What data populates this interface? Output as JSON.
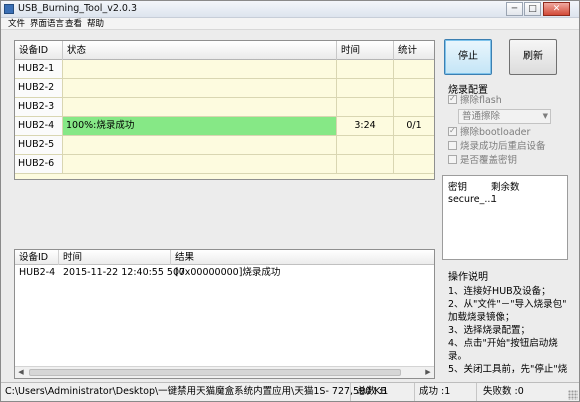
{
  "window": {
    "title": "USB_Burning_Tool_v2.0.3"
  },
  "titlebar": {
    "minimize": "─",
    "maximize": "□",
    "close": "✕"
  },
  "menu": [
    "文件",
    "界面语言",
    "查看",
    "帮助"
  ],
  "device_table": {
    "headers": [
      "设备ID",
      "状态",
      "时间",
      "统计"
    ],
    "rows": [
      {
        "id": "HUB2-1",
        "status": "",
        "time": "",
        "stat": ""
      },
      {
        "id": "HUB2-2",
        "status": "",
        "time": "",
        "stat": ""
      },
      {
        "id": "HUB2-3",
        "status": "",
        "time": "",
        "stat": ""
      },
      {
        "id": "HUB2-4",
        "status": "100%:烧录成功",
        "time": "3:24",
        "stat": "0/1"
      },
      {
        "id": "HUB2-5",
        "status": "",
        "time": "",
        "stat": ""
      },
      {
        "id": "HUB2-6",
        "status": "",
        "time": "",
        "stat": ""
      }
    ]
  },
  "log_table": {
    "headers": [
      "设备ID",
      "时间",
      "结果"
    ],
    "rows": [
      {
        "id": "HUB2-4",
        "time": "2015-11-22 12:40:55 507",
        "result": "[0x00000000]烧录成功"
      }
    ]
  },
  "buttons": {
    "start": "停止",
    "refresh": "刷新"
  },
  "config": {
    "title": "烧录配置",
    "erase_flash": "擦除flash",
    "erase_mode": "普通擦除",
    "erase_bootloader": "擦除bootloader",
    "reboot_after": "烧录成功后重启设备",
    "overwrite_key": "是否覆盖密钥"
  },
  "keys": {
    "headers": [
      "密钥",
      "剩余数"
    ],
    "rows": [
      {
        "name": "secure_...",
        "remaining": "1"
      }
    ]
  },
  "help": {
    "title": "操作说明",
    "lines": [
      "1、连接好HUB及设备；",
      "2、从\"文件\"－\"导入烧录包\"",
      "加载烧录镜像；",
      "3、选择烧录配置；",
      "4、点击\"开始\"按钮启动烧",
      "录。",
      "5、关闭工具前，先\"停止\"烧"
    ]
  },
  "statusbar": {
    "path": "C:\\Users\\Administrator\\Desktop\\一键禁用天猫魔盒系统内置应用\\天猫1S- 727,580 KB",
    "total": "总数 :1",
    "success": "成功 :1",
    "fail": "失败数 :0"
  }
}
